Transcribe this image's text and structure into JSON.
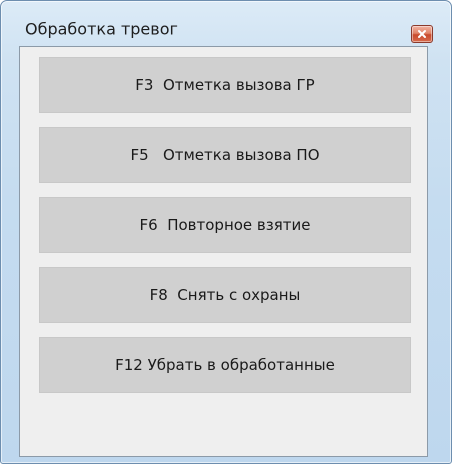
{
  "window": {
    "title": "Обработка тревог"
  },
  "buttons": [
    {
      "label": "F3  Отметка вызова ГР"
    },
    {
      "label": "F5   Отметка вызова ПО"
    },
    {
      "label": "F6  Повторное взятие"
    },
    {
      "label": "F8  Снять с охраны"
    },
    {
      "label": "F12 Убрать в обработанные"
    }
  ],
  "colors": {
    "close_button": "#d2583a",
    "button_face": "#d0d0d0",
    "panel_background": "#efefef"
  },
  "icons": {
    "close": "close-icon"
  }
}
